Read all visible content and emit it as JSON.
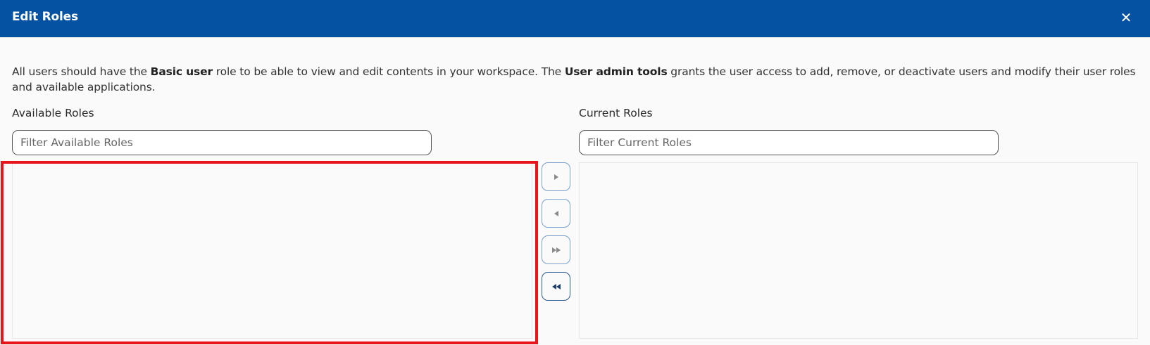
{
  "dialog": {
    "title": "Edit Roles",
    "close_symbol": "✕"
  },
  "description": {
    "part1": "All users should have the ",
    "bold1": "Basic user",
    "part2": " role to be able to view and edit contents in your workspace. The ",
    "bold2": "User admin tools",
    "part3": " grants the user access to add, remove, or deactivate users and modify their user roles and available applications."
  },
  "available": {
    "label": "Available Roles",
    "filter_placeholder": "Filter Available Roles",
    "filter_value": "",
    "items": []
  },
  "current": {
    "label": "Current Roles",
    "filter_placeholder": "Filter Current Roles",
    "filter_value": "",
    "items": []
  },
  "transfer_buttons": [
    {
      "name": "move-right-icon",
      "state": "disabled"
    },
    {
      "name": "move-left-icon",
      "state": "disabled"
    },
    {
      "name": "move-all-right-icon",
      "state": "disabled"
    },
    {
      "name": "move-all-left-icon",
      "state": "enabled"
    }
  ],
  "colors": {
    "header_bg": "#0552a3",
    "highlight_border": "#e8131b",
    "button_border": "#7aa0cf",
    "button_border_active": "#2a5a94",
    "icon_disabled": "#8a8a8a",
    "icon_active": "#1f3f66"
  }
}
